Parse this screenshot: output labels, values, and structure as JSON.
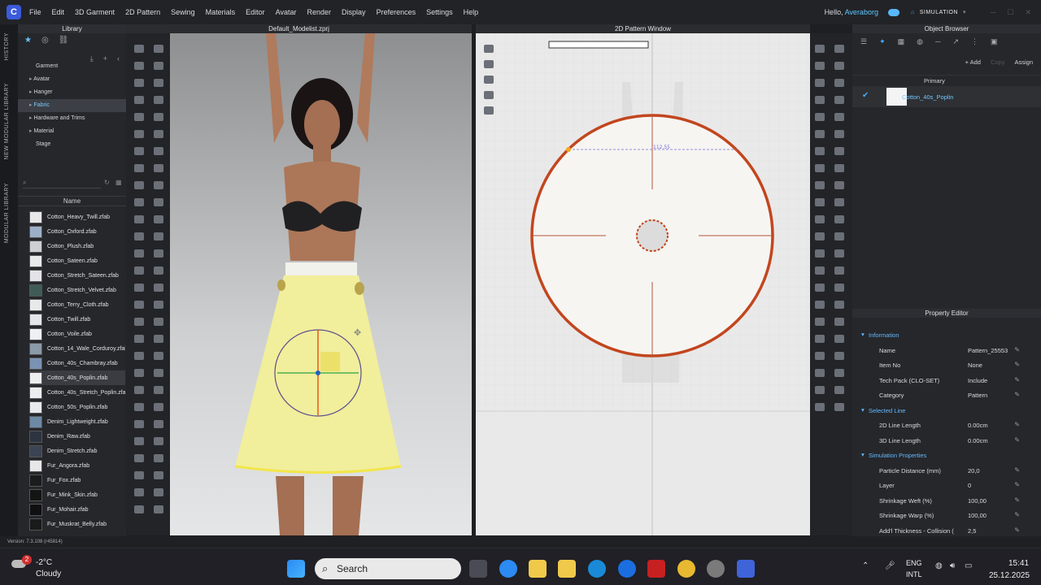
{
  "menu": {
    "items": [
      "File",
      "Edit",
      "3D Garment",
      "2D Pattern",
      "Sewing",
      "Materials",
      "Editor",
      "Avatar",
      "Render",
      "Display",
      "Preferences",
      "Settings",
      "Help"
    ],
    "hello_prefix": "Hello,",
    "user": "Averaborg",
    "mode": "SIMULATION"
  },
  "side_tabs": [
    "HISTORY",
    "NEW MODULAR LIBRARY",
    "MODULAR LIBRARY"
  ],
  "library": {
    "title": "Library",
    "tree": [
      {
        "label": "Garment",
        "sub": false,
        "selected": false
      },
      {
        "label": "Avatar",
        "sub": true,
        "selected": false
      },
      {
        "label": "Hanger",
        "sub": true,
        "selected": false
      },
      {
        "label": "Fabric",
        "sub": true,
        "selected": true
      },
      {
        "label": "Hardware and Trims",
        "sub": true,
        "selected": false
      },
      {
        "label": "Material",
        "sub": true,
        "selected": false
      },
      {
        "label": "Stage",
        "sub": false,
        "selected": false
      }
    ],
    "column_header": "Name",
    "files": [
      {
        "name": "Cotton_Heavy_Twill.zfab",
        "color": "#e8e8ea"
      },
      {
        "name": "Cotton_Oxford.zfab",
        "color": "#9db0c9"
      },
      {
        "name": "Cotton_Plush.zfab",
        "color": "#cfcfd3"
      },
      {
        "name": "Cotton_Sateen.zfab",
        "color": "#e9e9eb"
      },
      {
        "name": "Cotton_Stretch_Sateen.zfab",
        "color": "#e4e4e6"
      },
      {
        "name": "Cotton_Stretch_Velvet.zfab",
        "color": "#3f5d55"
      },
      {
        "name": "Cotton_Terry_Cloth.zfab",
        "color": "#e9e9ea"
      },
      {
        "name": "Cotton_Twill.zfab",
        "color": "#e6e6e8"
      },
      {
        "name": "Cotton_Voile.zfab",
        "color": "#f0f0f2"
      },
      {
        "name": "Cotton_14_Wale_Corduroy.zfab",
        "color": "#8a9aa8"
      },
      {
        "name": "Cotton_40s_Chambray.zfab",
        "color": "#7a93b3"
      },
      {
        "name": "Cotton_40s_Poplin.zfab",
        "color": "#eeeef0"
      },
      {
        "name": "Cotton_40s_Stretch_Poplin.zfab",
        "color": "#ececee"
      },
      {
        "name": "Cotton_50s_Poplin.zfab",
        "color": "#eaeaec"
      },
      {
        "name": "Denim_Lightweight.zfab",
        "color": "#6d89a6"
      },
      {
        "name": "Denim_Raw.zfab",
        "color": "#2d3440"
      },
      {
        "name": "Denim_Stretch.zfab",
        "color": "#3b4453"
      },
      {
        "name": "Fur_Angora.zfab",
        "color": "#e7e7e9"
      },
      {
        "name": "Fur_Fox.zfab",
        "color": "#1c1c1d"
      },
      {
        "name": "Fur_Mink_Skin.zfab",
        "color": "#141415"
      },
      {
        "name": "Fur_Mohair.zfab",
        "color": "#101012"
      },
      {
        "name": "Fur_Muskrat_Belly.zfab",
        "color": "#1a1a1b"
      }
    ],
    "selected_file_index": 11
  },
  "viewport3d": {
    "title": "Default_Modelist.zprj"
  },
  "viewport2d": {
    "title": "2D Pattern Window",
    "measure_label": "112.55"
  },
  "object_browser": {
    "title": "Object Browser",
    "add_label": "+ Add",
    "copy_label": "Copy",
    "assign_label": "Assign",
    "primary_label": "Primary",
    "fabric_name": "Cotton_40s_Poplin"
  },
  "property_editor": {
    "title": "Property Editor",
    "rows": [
      {
        "key": "Information",
        "value": "",
        "section": true
      },
      {
        "key": "Name",
        "value": "Pattern_25553",
        "section": false
      },
      {
        "key": "Item No",
        "value": "None",
        "section": false
      },
      {
        "key": "Tech Pack (CLO-SET)",
        "value": "Include",
        "section": false
      },
      {
        "key": "Category",
        "value": "Pattern",
        "section": false
      },
      {
        "key": "Selected Line",
        "value": "",
        "section": true
      },
      {
        "key": "2D Line Length",
        "value": "0.00cm",
        "section": false
      },
      {
        "key": "3D Line Length",
        "value": "0.00cm",
        "section": false
      },
      {
        "key": "Simulation Properties",
        "value": "",
        "section": true
      },
      {
        "key": "Particle Distance (mm)",
        "value": "20,0",
        "section": false
      },
      {
        "key": "Layer",
        "value": "0",
        "section": false
      },
      {
        "key": "Shrinkage Weft (%)",
        "value": "100,00",
        "section": false
      },
      {
        "key": "Shrinkage Warp (%)",
        "value": "100,00",
        "section": false
      },
      {
        "key": "Add'l Thickness - Collision (",
        "value": "2,5",
        "section": false
      }
    ]
  },
  "status": {
    "version": "Version: 7.3.108 (r45814)"
  },
  "taskbar": {
    "weather_temp": "-2°C",
    "weather_desc": "Cloudy",
    "notification_count": "2",
    "search_placeholder": "Search",
    "lang": "ENG",
    "layout": "INTL",
    "time": "15:41",
    "date": "25.12.2025"
  },
  "colors": {
    "accent": "#4aa8ff",
    "seam": "#c2461e",
    "skirt": "#f1ee9c"
  }
}
